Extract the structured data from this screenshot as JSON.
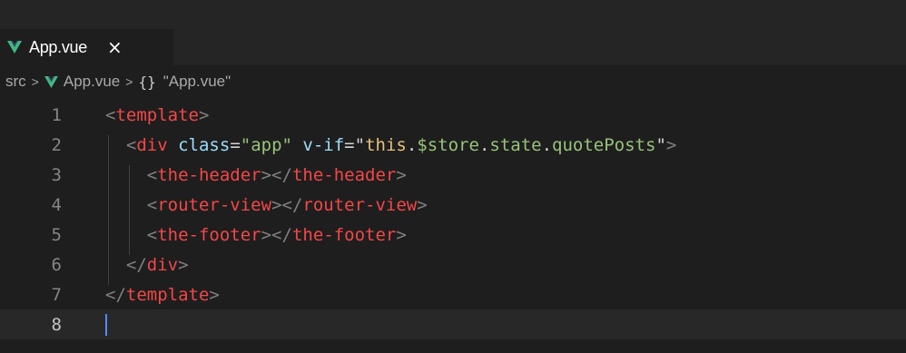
{
  "tab": {
    "label": "App.vue",
    "close_label": "×"
  },
  "breadcrumb": {
    "folder": "src",
    "separator": ">",
    "file": "App.vue",
    "symbol_icon": "{}",
    "symbol": "\"App.vue\""
  },
  "editor": {
    "line_numbers": [
      "1",
      "2",
      "3",
      "4",
      "5",
      "6",
      "7",
      "8"
    ],
    "lines": [
      {
        "indent": "",
        "tokens": [
          {
            "text": "<",
            "cls": "p"
          },
          {
            "text": "template",
            "cls": "tr"
          },
          {
            "text": ">",
            "cls": "p"
          }
        ]
      },
      {
        "indent": "  ",
        "tokens": [
          {
            "text": "<",
            "cls": "p"
          },
          {
            "text": "div",
            "cls": "tr"
          },
          {
            "text": " class",
            "cls": "a"
          },
          {
            "text": "=",
            "cls": "w"
          },
          {
            "text": "\"app\"",
            "cls": "sg"
          },
          {
            "text": " v-if",
            "cls": "a"
          },
          {
            "text": "=",
            "cls": "w"
          },
          {
            "text": "\"",
            "cls": "w"
          },
          {
            "text": "this",
            "cls": "kw"
          },
          {
            "text": ".",
            "cls": "w"
          },
          {
            "text": "$store",
            "cls": "sg"
          },
          {
            "text": ".",
            "cls": "w"
          },
          {
            "text": "state",
            "cls": "sg"
          },
          {
            "text": ".",
            "cls": "w"
          },
          {
            "text": "quotePosts",
            "cls": "sg"
          },
          {
            "text": "\"",
            "cls": "w"
          },
          {
            "text": ">",
            "cls": "p"
          }
        ]
      },
      {
        "indent": "    ",
        "tokens": [
          {
            "text": "<",
            "cls": "p"
          },
          {
            "text": "the-header",
            "cls": "tr"
          },
          {
            "text": "></",
            "cls": "p"
          },
          {
            "text": "the-header",
            "cls": "tr"
          },
          {
            "text": ">",
            "cls": "p"
          }
        ]
      },
      {
        "indent": "    ",
        "tokens": [
          {
            "text": "<",
            "cls": "p"
          },
          {
            "text": "router-view",
            "cls": "tr"
          },
          {
            "text": "></",
            "cls": "p"
          },
          {
            "text": "router-view",
            "cls": "tr"
          },
          {
            "text": ">",
            "cls": "p"
          }
        ]
      },
      {
        "indent": "    ",
        "tokens": [
          {
            "text": "<",
            "cls": "p"
          },
          {
            "text": "the-footer",
            "cls": "tr"
          },
          {
            "text": "></",
            "cls": "p"
          },
          {
            "text": "the-footer",
            "cls": "tr"
          },
          {
            "text": ">",
            "cls": "p"
          }
        ]
      },
      {
        "indent": "  ",
        "tokens": [
          {
            "text": "</",
            "cls": "p"
          },
          {
            "text": "div",
            "cls": "tr"
          },
          {
            "text": ">",
            "cls": "p"
          }
        ]
      },
      {
        "indent": "",
        "tokens": [
          {
            "text": "</",
            "cls": "p"
          },
          {
            "text": "template",
            "cls": "tr"
          },
          {
            "text": ">",
            "cls": "p"
          }
        ]
      },
      {
        "indent": "",
        "tokens": []
      }
    ],
    "active_line": 8
  },
  "colors": {
    "background": "#1e1e1e",
    "tab_strip": "#252526",
    "active_line": "#282828",
    "caret": "#528bff",
    "vue_green": "#41b883",
    "vue_dark": "#35495e"
  },
  "icons": {
    "file_icon": "vue-logo-icon",
    "close_icon": "close-icon",
    "symbol_icon": "curly-braces-icon"
  }
}
